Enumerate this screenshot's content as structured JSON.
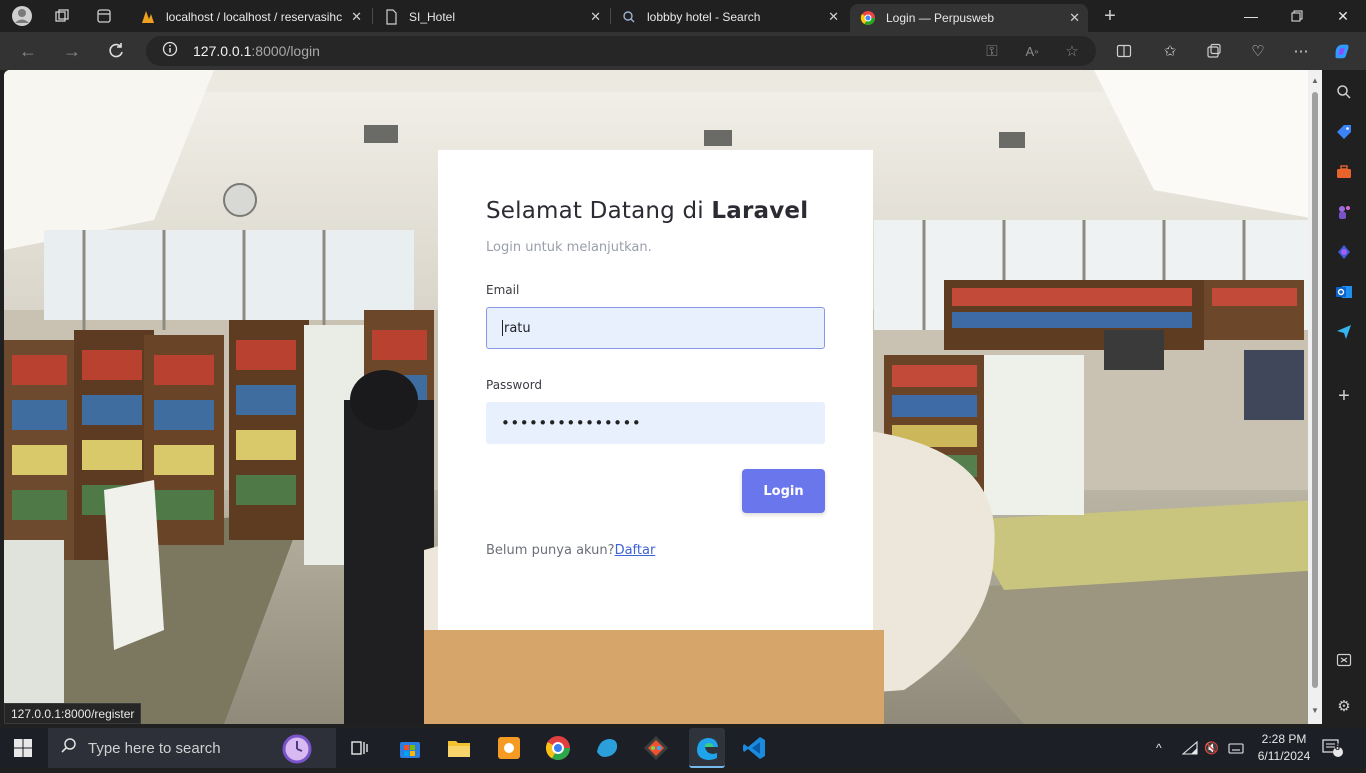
{
  "browser": {
    "tabs": [
      {
        "title": "localhost / localhost / reservasihc",
        "active": false
      },
      {
        "title": "SI_Hotel",
        "active": false
      },
      {
        "title": "lobbby hotel - Search",
        "active": false
      },
      {
        "title": "Login — Perpusweb",
        "active": true
      }
    ],
    "url_host": "127.0.0.1",
    "url_path": ":8000/login",
    "status_url": "127.0.0.1:8000/register"
  },
  "page": {
    "heading_prefix": "Selamat Datang di ",
    "heading_brand": "Laravel",
    "subtitle": "Login untuk melanjutkan.",
    "email_label": "Email",
    "email_value": "ratu",
    "password_label": "Password",
    "password_value": "•••••••••••••••",
    "login_button": "Login",
    "register_prompt": "Belum punya akun?",
    "register_link": "Daftar"
  },
  "taskbar": {
    "search_placeholder": "Type here to search",
    "time": "2:28 PM",
    "date": "6/11/2024",
    "notification_count": "8"
  },
  "colors": {
    "accent": "#6a77ec",
    "input_bg": "#e8f0fe"
  }
}
